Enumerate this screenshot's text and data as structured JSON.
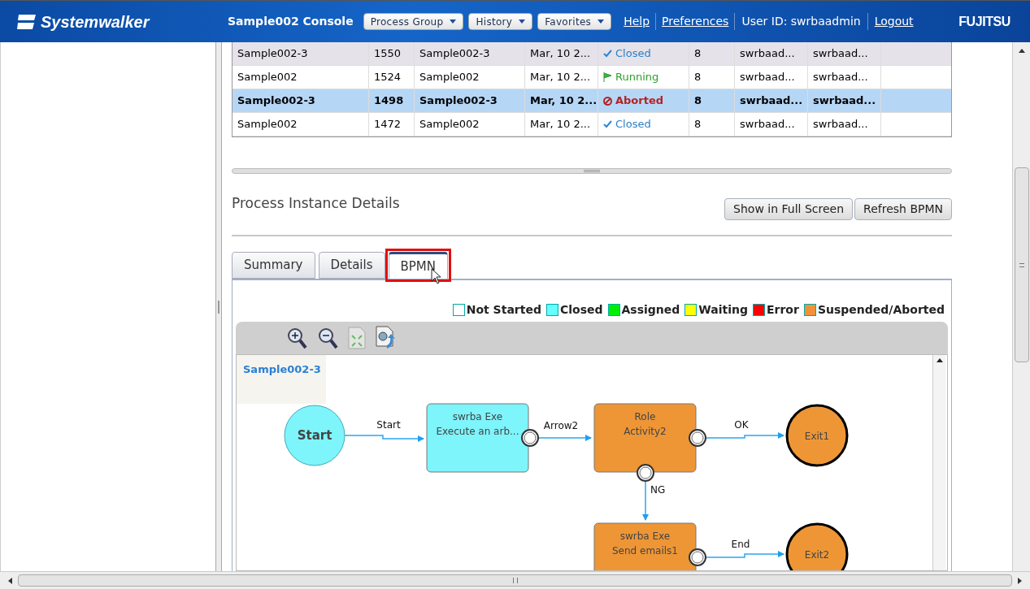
{
  "header": {
    "logo": "Systemwalker",
    "title": "Sample002 Console",
    "menus": [
      "Process Group",
      "History",
      "Favorites"
    ],
    "links": [
      "Help",
      "Preferences"
    ],
    "user": "User ID: swrbaadmin",
    "logout": "Logout",
    "brand": "FUJITSU"
  },
  "table": {
    "rows": [
      {
        "cells": [
          "Sample002-3",
          "1550",
          "Sample002-3",
          "Mar, 10 2...",
          "8",
          "swrbaad...",
          "swrbaad..."
        ],
        "status": {
          "kind": "closed",
          "label": "Closed"
        },
        "selected": false,
        "hovered": true
      },
      {
        "cells": [
          "Sample002",
          "1524",
          "Sample002",
          "Mar, 10 2...",
          "8",
          "swrbaad...",
          "swrbaad..."
        ],
        "status": {
          "kind": "running",
          "label": "Running"
        },
        "selected": false,
        "hovered": false
      },
      {
        "cells": [
          "Sample002-3",
          "1498",
          "Sample002-3",
          "Mar, 10 2...",
          "8",
          "swrbaad...",
          "swrbaad..."
        ],
        "status": {
          "kind": "aborted",
          "label": "Aborted"
        },
        "selected": true,
        "hovered": false
      },
      {
        "cells": [
          "Sample002",
          "1472",
          "Sample002",
          "Mar, 10 2...",
          "8",
          "swrbaad...",
          "swrbaad..."
        ],
        "status": {
          "kind": "closed",
          "label": "Closed"
        },
        "selected": false,
        "hovered": false
      }
    ]
  },
  "details": {
    "title": "Process Instance Details",
    "buttons": [
      "Show in Full Screen",
      "Refresh BPMN"
    ],
    "tabs": [
      {
        "label": "Summary",
        "selected": false
      },
      {
        "label": "Details",
        "selected": false
      },
      {
        "label": "BPMN",
        "selected": true
      }
    ],
    "legend": [
      {
        "label": "Not Started",
        "color": "#ffffff"
      },
      {
        "label": "Closed",
        "color": "#66ffff"
      },
      {
        "label": "Assigned",
        "color": "#00ee00"
      },
      {
        "label": "Waiting",
        "color": "#ffff00"
      },
      {
        "label": "Error",
        "color": "#ff0000"
      },
      {
        "label": "Suspended/Aborted",
        "color": "#f0923a"
      }
    ],
    "diagram": {
      "name": "Sample002-3",
      "nodes": [
        {
          "kind": "start",
          "lines": [
            "Start"
          ],
          "color": "#7ef4fb"
        },
        {
          "kind": "task",
          "lines": [
            "swrba  Exe",
            "Execute an arb..."
          ],
          "color": "#7ef4fb"
        },
        {
          "kind": "task",
          "lines": [
            "Role",
            "Activity2"
          ],
          "color": "#ee9636"
        },
        {
          "kind": "end",
          "lines": [
            "Exit1"
          ],
          "color": "#ee9636"
        },
        {
          "kind": "task",
          "lines": [
            "swrba  Exe",
            "Send emails1"
          ],
          "color": "#ee9636"
        },
        {
          "kind": "end",
          "lines": [
            "Exit2"
          ],
          "color": "#ee9636"
        }
      ],
      "edges": [
        {
          "label": "Start"
        },
        {
          "label": "Arrow2"
        },
        {
          "label": "OK"
        },
        {
          "label": "NG"
        },
        {
          "label": "End"
        }
      ]
    }
  }
}
